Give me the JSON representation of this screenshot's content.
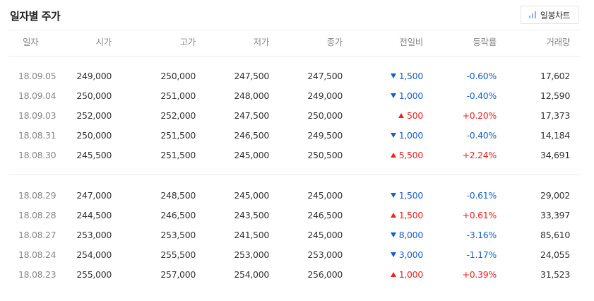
{
  "title": "일자별 주가",
  "chart_button": {
    "label": "일봉차트",
    "icon": "bar-chart-icon"
  },
  "colors": {
    "up": "#e22222",
    "down": "#1a5fc8"
  },
  "columns": [
    "일자",
    "시가",
    "고가",
    "저가",
    "종가",
    "전일비",
    "등락률",
    "거래량"
  ],
  "groups": [
    [
      {
        "date": "18.09.05",
        "open": "249,000",
        "high": "250,000",
        "low": "247,500",
        "close": "247,500",
        "dir": "down",
        "change": "1,500",
        "rate": "-0.60%",
        "volume": "17,602"
      },
      {
        "date": "18.09.04",
        "open": "250,000",
        "high": "251,000",
        "low": "248,000",
        "close": "249,000",
        "dir": "down",
        "change": "1,000",
        "rate": "-0.40%",
        "volume": "12,590"
      },
      {
        "date": "18.09.03",
        "open": "252,000",
        "high": "252,000",
        "low": "247,500",
        "close": "250,000",
        "dir": "up",
        "change": "500",
        "rate": "+0.20%",
        "volume": "17,373"
      },
      {
        "date": "18.08.31",
        "open": "250,000",
        "high": "251,500",
        "low": "246,500",
        "close": "249,500",
        "dir": "down",
        "change": "1,000",
        "rate": "-0.40%",
        "volume": "14,184"
      },
      {
        "date": "18.08.30",
        "open": "245,500",
        "high": "251,500",
        "low": "245,000",
        "close": "250,500",
        "dir": "up",
        "change": "5,500",
        "rate": "+2.24%",
        "volume": "34,691"
      }
    ],
    [
      {
        "date": "18.08.29",
        "open": "247,000",
        "high": "248,500",
        "low": "245,000",
        "close": "245,000",
        "dir": "down",
        "change": "1,500",
        "rate": "-0.61%",
        "volume": "29,002"
      },
      {
        "date": "18.08.28",
        "open": "244,500",
        "high": "246,500",
        "low": "243,500",
        "close": "246,500",
        "dir": "up",
        "change": "1,500",
        "rate": "+0.61%",
        "volume": "33,397"
      },
      {
        "date": "18.08.27",
        "open": "253,000",
        "high": "253,500",
        "low": "241,500",
        "close": "245,000",
        "dir": "down",
        "change": "8,000",
        "rate": "-3.16%",
        "volume": "85,610"
      },
      {
        "date": "18.08.24",
        "open": "254,000",
        "high": "255,500",
        "low": "253,000",
        "close": "253,000",
        "dir": "down",
        "change": "3,000",
        "rate": "-1.17%",
        "volume": "24,055"
      },
      {
        "date": "18.08.23",
        "open": "255,000",
        "high": "257,000",
        "low": "254,000",
        "close": "256,000",
        "dir": "up",
        "change": "1,000",
        "rate": "+0.39%",
        "volume": "31,523"
      }
    ]
  ]
}
